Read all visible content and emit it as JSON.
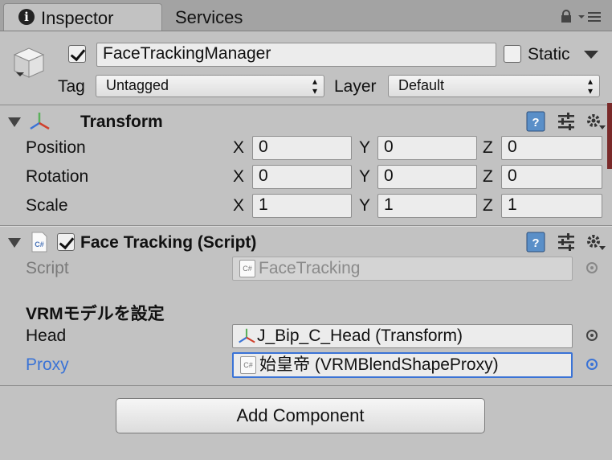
{
  "tabs": {
    "inspector": "Inspector",
    "services": "Services"
  },
  "gameobject": {
    "active": true,
    "name": "FaceTrackingManager",
    "static_label": "Static",
    "static_checked": false
  },
  "tag": {
    "label": "Tag",
    "value": "Untagged"
  },
  "layer": {
    "label": "Layer",
    "value": "Default"
  },
  "transform": {
    "title": "Transform",
    "rows": [
      {
        "label": "Position",
        "x": "0",
        "y": "0",
        "z": "0"
      },
      {
        "label": "Rotation",
        "x": "0",
        "y": "0",
        "z": "0"
      },
      {
        "label": "Scale",
        "x": "1",
        "y": "1",
        "z": "1"
      }
    ],
    "axes": {
      "x": "X",
      "y": "Y",
      "z": "Z"
    }
  },
  "face_tracking": {
    "title": "Face Tracking (Script)",
    "enabled": true,
    "script_label": "Script",
    "script_value": "FaceTracking",
    "section_header": "VRMモデルを設定",
    "head_label": "Head",
    "head_value": "J_Bip_C_Head (Transform)",
    "proxy_label": "Proxy",
    "proxy_value": "始皇帝 (VRMBlendShapeProxy)",
    "cs_badge": "C#"
  },
  "add_component": "Add Component",
  "colors": {
    "accent_blue": "#3a73d6",
    "panel_bg": "#c2c2c2",
    "tab_bar": "#a3a3a3"
  }
}
